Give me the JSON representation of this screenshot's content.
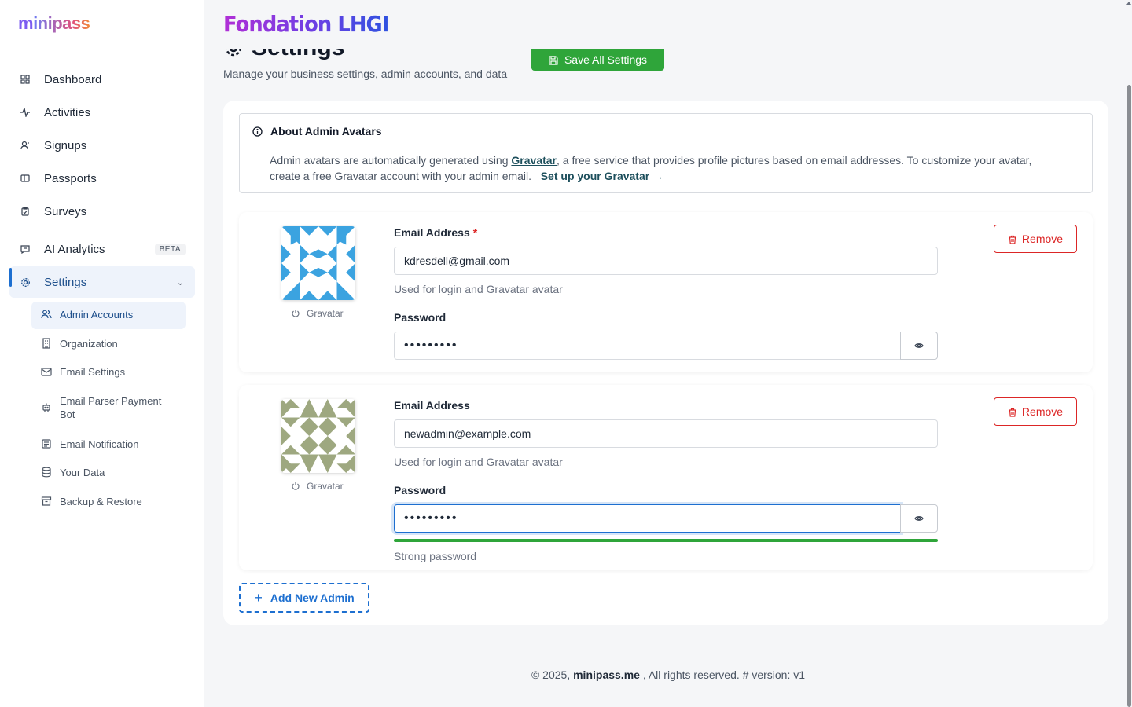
{
  "brand": {
    "logo_first": "m",
    "logo_rest": "inipass"
  },
  "sidebar": {
    "items": [
      {
        "label": "Dashboard",
        "icon": "grid-icon"
      },
      {
        "label": "Activities",
        "icon": "activity-icon"
      },
      {
        "label": "Signups",
        "icon": "user-icon"
      },
      {
        "label": "Passports",
        "icon": "ticket-icon"
      },
      {
        "label": "Surveys",
        "icon": "clipboard-icon"
      },
      {
        "label": "AI Analytics",
        "icon": "message-icon",
        "badge": "BETA"
      },
      {
        "label": "Settings",
        "icon": "gear-icon",
        "active": true
      }
    ],
    "sub_items": [
      {
        "label": "Admin Accounts",
        "icon": "users-icon",
        "active": true
      },
      {
        "label": "Organization",
        "icon": "building-icon"
      },
      {
        "label": "Email Settings",
        "icon": "mail-icon"
      },
      {
        "label": "Email Parser Payment Bot",
        "icon": "bot-icon"
      },
      {
        "label": "Email Notification",
        "icon": "list-icon"
      },
      {
        "label": "Your Data",
        "icon": "database-icon"
      },
      {
        "label": "Backup & Restore",
        "icon": "archive-icon"
      }
    ]
  },
  "header": {
    "org_name": "Fondation LHGI",
    "page_title": "Settings",
    "page_subtitle": "Manage your business settings, admin accounts, and data",
    "save_label": "Save All Settings"
  },
  "info": {
    "title": "About Admin Avatars",
    "text_before": "Admin avatars are automatically generated using ",
    "link1": "Gravatar",
    "text_after": ", a free service that provides profile pictures based on email addresses. To customize your avatar, create a free Gravatar account with your admin email.",
    "link2": "Set up your Gravatar →"
  },
  "admins": [
    {
      "avatar_color": "#3ba3e0",
      "gravatar_label": "Gravatar",
      "email_label": "Email Address",
      "required": "*",
      "email": "kdresdell@gmail.com",
      "email_help": "Used for login and Gravatar avatar",
      "password_label": "Password",
      "password": "•••••••••",
      "remove_label": "Remove"
    },
    {
      "avatar_color": "#9ea880",
      "gravatar_label": "Gravatar",
      "email_label": "Email Address",
      "email": "newadmin@example.com",
      "email_help": "Used for login and Gravatar avatar",
      "password_label": "Password",
      "password": "•••••••••",
      "strength": 1.0,
      "strength_label": "Strong password",
      "remove_label": "Remove"
    }
  ],
  "add_admin_label": "Add New Admin",
  "footer": {
    "prefix": "© 2025, ",
    "brand": "minipass.me",
    "suffix": " , All rights reserved. # version: v1"
  },
  "colors": {
    "accent": "#1d6fd0",
    "save_green": "#2fa53a",
    "danger": "#dc2626"
  }
}
